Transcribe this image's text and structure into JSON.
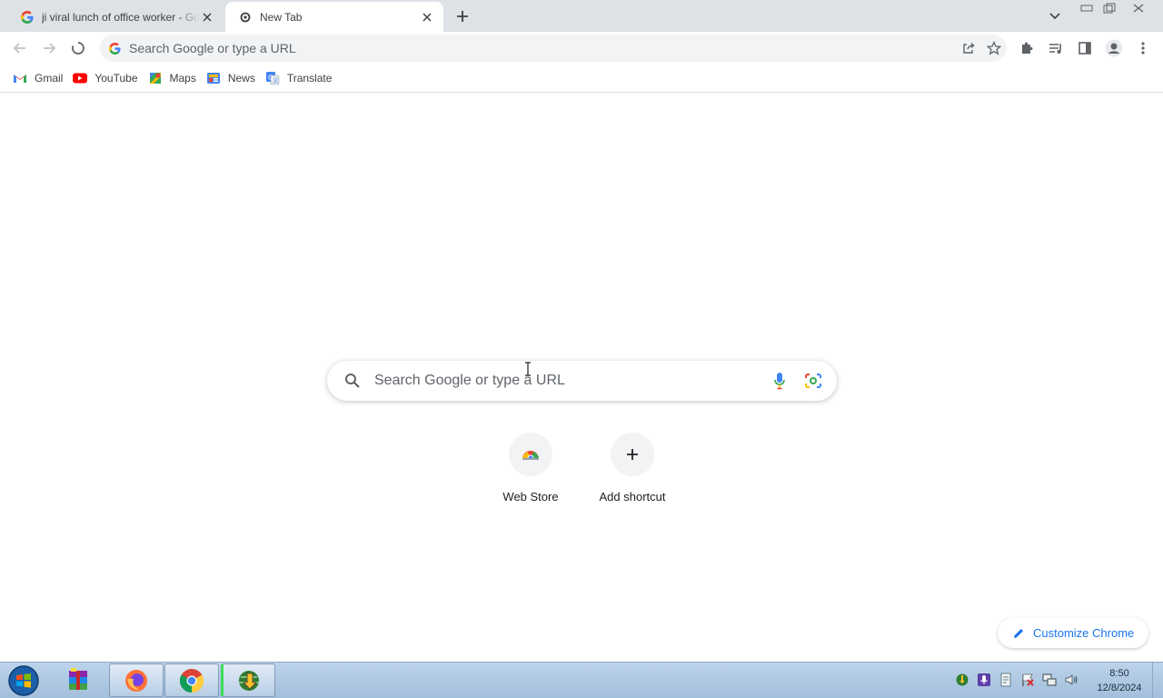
{
  "tabs": [
    {
      "title": "ji viral lunch of office worker - Go",
      "favicon": "google-g-icon",
      "active": false
    },
    {
      "title": "New Tab",
      "favicon": "chrome-loading-icon",
      "active": true
    }
  ],
  "omnibox": {
    "placeholder": "Search Google or type a URL"
  },
  "bookmarks": [
    {
      "label": "Gmail",
      "icon": "gmail-icon"
    },
    {
      "label": "YouTube",
      "icon": "youtube-icon"
    },
    {
      "label": "Maps",
      "icon": "maps-icon"
    },
    {
      "label": "News",
      "icon": "news-icon"
    },
    {
      "label": "Translate",
      "icon": "translate-icon"
    }
  ],
  "ntp": {
    "search_placeholder": "Search Google or type a URL",
    "shortcuts": [
      {
        "label": "Web Store",
        "icon": "web-store-icon"
      },
      {
        "label": "Add shortcut",
        "icon": "plus-icon"
      }
    ],
    "customize_label": "Customize Chrome"
  },
  "taskbar": {
    "apps": [
      "winrar-icon",
      "firefox-icon",
      "chrome-icon",
      "idm-icon"
    ],
    "clock_time": "8:50",
    "clock_date": "12/8/2024"
  },
  "colors": {
    "accent": "#1a73e8",
    "tabstrip": "#dee1e6",
    "taskbar": "#bcd3ea"
  }
}
